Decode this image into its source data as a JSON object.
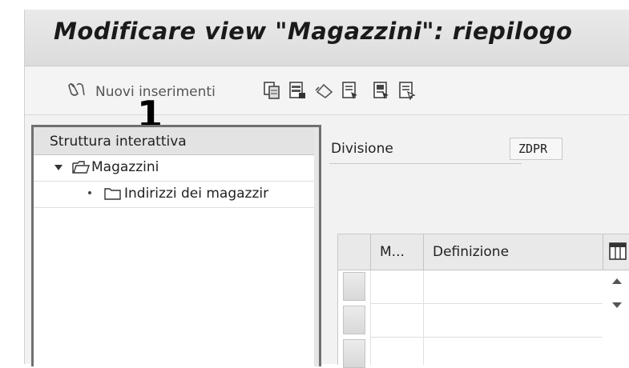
{
  "window": {
    "title": "Modificare view \"Magazzini\": riepilogo"
  },
  "toolbar": {
    "new_entries_label": "Nuovi inserimenti",
    "icons": [
      "glasses-icon",
      "copy-icon",
      "delete-icon",
      "undo-icon",
      "select-all-icon",
      "select-block-icon",
      "deselect-all-icon"
    ]
  },
  "annotation": {
    "step_number": "1"
  },
  "tree": {
    "header": "Struttura interattiva",
    "items": [
      {
        "label": "Magazzini",
        "expanded": true,
        "icon": "folder-open-icon"
      },
      {
        "label": "Indirizzi dei magazzir",
        "icon": "folder-icon"
      }
    ]
  },
  "division": {
    "label": "Divisione",
    "value": "ZDPR"
  },
  "table": {
    "columns": [
      "M...",
      "Definizione"
    ],
    "rows": [
      {
        "m": "",
        "definizione": ""
      },
      {
        "m": "",
        "definizione": ""
      },
      {
        "m": "",
        "definizione": ""
      }
    ]
  },
  "colors": {
    "title_bar": "#dedede",
    "panel_border": "#707070",
    "background": "#f2f2f2"
  }
}
